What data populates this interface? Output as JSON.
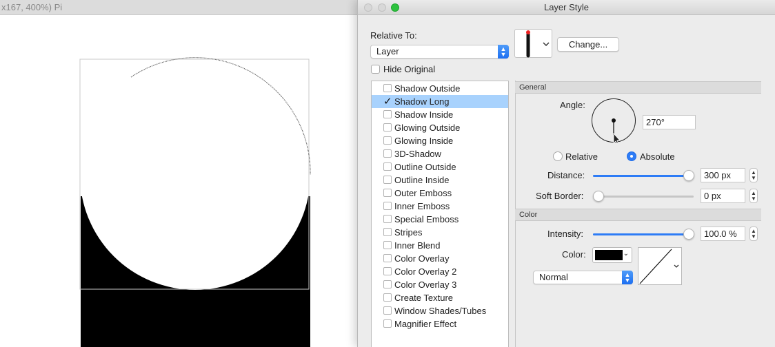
{
  "document": {
    "title_fragment": "x167, 400%) Pi"
  },
  "dialog": {
    "title": "Layer Style",
    "relative_to_label": "Relative To:",
    "relative_to_value": "Layer",
    "change_button": "Change...",
    "hide_original_label": "Hide Original",
    "effects": [
      {
        "label": "Shadow Outside",
        "checked": false
      },
      {
        "label": "Shadow Long",
        "checked": true
      },
      {
        "label": "Shadow Inside",
        "checked": false
      },
      {
        "label": "Glowing Outside",
        "checked": false
      },
      {
        "label": "Glowing Inside",
        "checked": false
      },
      {
        "label": "3D-Shadow",
        "checked": false
      },
      {
        "label": "Outline Outside",
        "checked": false
      },
      {
        "label": "Outline Inside",
        "checked": false
      },
      {
        "label": "Outer Emboss",
        "checked": false
      },
      {
        "label": "Inner Emboss",
        "checked": false
      },
      {
        "label": "Special Emboss",
        "checked": false
      },
      {
        "label": "Stripes",
        "checked": false
      },
      {
        "label": "Inner Blend",
        "checked": false
      },
      {
        "label": "Color Overlay",
        "checked": false
      },
      {
        "label": "Color Overlay 2",
        "checked": false
      },
      {
        "label": "Color Overlay 3",
        "checked": false
      },
      {
        "label": "Create Texture",
        "checked": false
      },
      {
        "label": "Window Shades/Tubes",
        "checked": false
      },
      {
        "label": "Magnifier Effect",
        "checked": false
      }
    ],
    "general": {
      "header": "General",
      "angle_label": "Angle:",
      "angle_value": "270°",
      "relative_label": "Relative",
      "absolute_label": "Absolute",
      "mode_selected": "Absolute",
      "distance_label": "Distance:",
      "distance_value": "300 px",
      "distance_fraction": 1.0,
      "soft_border_label": "Soft Border:",
      "soft_border_value": "0 px",
      "soft_border_fraction": 0.0
    },
    "color": {
      "header": "Color",
      "intensity_label": "Intensity:",
      "intensity_value": "100.0 %",
      "intensity_fraction": 1.0,
      "color_label": "Color:",
      "color_swatch": "#000000",
      "blend_mode": "Normal"
    },
    "colors": {
      "accent": "#2e7cf6",
      "selection": "#a8d2fd",
      "close_button": "#2dc23f"
    }
  }
}
